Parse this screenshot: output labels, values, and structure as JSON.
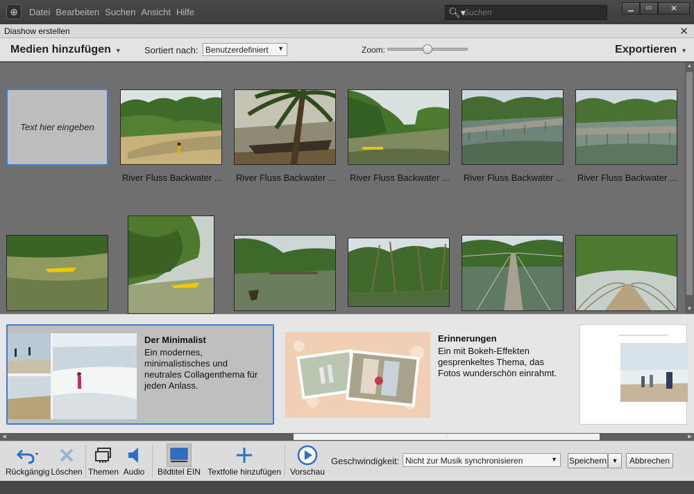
{
  "menubar": {
    "items": [
      "Datei",
      "Bearbeiten",
      "Suchen",
      "Ansicht",
      "Hilfe"
    ],
    "search_placeholder": "Suchen"
  },
  "dialog": {
    "title": "Diashow erstellen"
  },
  "toolbar": {
    "add_media": "Medien hinzufügen",
    "sort_label": "Sortiert nach:",
    "sort_value": "Benutzerdefiniert",
    "zoom_label": "Zoom:",
    "zoom_level": 0.5,
    "export": "Exportieren"
  },
  "grid": {
    "text_tile": "Text hier eingeben",
    "captions": [
      "River Fluss Backwater ...",
      "River Fluss Backwater ...",
      "River Fluss Backwater ...",
      "River Fluss Backwater ...",
      "River Fluss Backwater ..."
    ]
  },
  "themes": [
    {
      "name": "Der Minimalist",
      "description": "Ein modernes, minimalistisches und neutrales Collagenthema für jeden Anlass."
    },
    {
      "name": "Erinnerungen",
      "description": "Ein mit Bokeh-Effekten gesprenkeltes Thema, das Fotos wunderschön einrahmt."
    }
  ],
  "bottombar": {
    "undo": "Rückgängig",
    "delete": "Löschen",
    "themes": "Themen",
    "audio": "Audio",
    "captions_on": "Bildtitel EIN",
    "add_text_slide": "Textfolie hinzufügen",
    "preview": "Vorschau",
    "speed_label": "Geschwindigkeit:",
    "speed_value": "Nicht zur Musik synchronisieren",
    "save": "Speichern",
    "cancel": "Abbrechen"
  },
  "colors": {
    "accent": "#3d7bd6",
    "panel": "#e6e6e6",
    "grid_bg": "#6f6f6f"
  }
}
